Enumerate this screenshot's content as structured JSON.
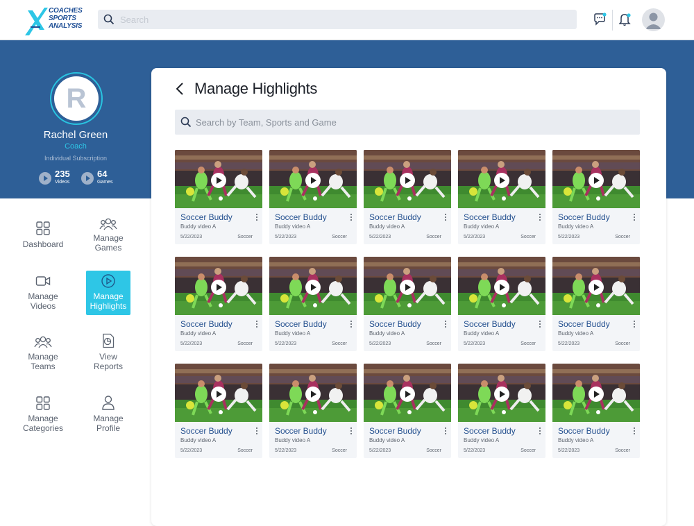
{
  "brand": {
    "logo_text": "COACHES SPORTS ANALYSIS",
    "accent": "#2ec6e6",
    "primary": "#2e5f97"
  },
  "topbar": {
    "search_placeholder": "Search",
    "icons": [
      "search-icon",
      "chat-icon",
      "bell-icon",
      "user-avatar"
    ]
  },
  "profile": {
    "initial": "R",
    "name": "Rachel Green",
    "role": "Coach",
    "subscription": "Individual Subscription",
    "stats": [
      {
        "value": "235",
        "label": "Videos"
      },
      {
        "value": "64",
        "label": "Games"
      }
    ]
  },
  "sidebar": {
    "items": [
      {
        "label": "Dashboard",
        "icon": "grid-icon"
      },
      {
        "label": "Manage Games",
        "icon": "users-icon"
      },
      {
        "label": "Manage Videos",
        "icon": "video-icon"
      },
      {
        "label": "Manage Highlights",
        "icon": "play-circle-icon",
        "active": true
      },
      {
        "label": "Manage Teams",
        "icon": "team-icon"
      },
      {
        "label": "View Reports",
        "icon": "report-icon"
      },
      {
        "label": "Manage Categories",
        "icon": "grid-icon"
      },
      {
        "label": "Manage Profile",
        "icon": "profile-icon"
      }
    ]
  },
  "main": {
    "title": "Manage Highlights",
    "search_placeholder": "Search by Team, Sports and Game",
    "cards": [
      {
        "title": "Soccer Buddy",
        "subtitle": "Buddy video A",
        "date": "5/22/2023",
        "category": "Soccer"
      },
      {
        "title": "Soccer Buddy",
        "subtitle": "Buddy video A",
        "date": "5/22/2023",
        "category": "Soccer"
      },
      {
        "title": "Soccer Buddy",
        "subtitle": "Buddy video A",
        "date": "5/22/2023",
        "category": "Soccer"
      },
      {
        "title": "Soccer Buddy",
        "subtitle": "Buddy video A",
        "date": "5/22/2023",
        "category": "Soccer"
      },
      {
        "title": "Soccer Buddy",
        "subtitle": "Buddy video A",
        "date": "5/22/2023",
        "category": "Soccer"
      },
      {
        "title": "Soccer Buddy",
        "subtitle": "Buddy video A",
        "date": "5/22/2023",
        "category": "Soccer"
      },
      {
        "title": "Soccer Buddy",
        "subtitle": "Buddy video A",
        "date": "5/22/2023",
        "category": "Soccer"
      },
      {
        "title": "Soccer Buddy",
        "subtitle": "Buddy video A",
        "date": "5/22/2023",
        "category": "Soccer"
      },
      {
        "title": "Soccer Buddy",
        "subtitle": "Buddy video A",
        "date": "5/22/2023",
        "category": "Soccer"
      },
      {
        "title": "Soccer Buddy",
        "subtitle": "Buddy video A",
        "date": "5/22/2023",
        "category": "Soccer"
      },
      {
        "title": "Soccer Buddy",
        "subtitle": "Buddy video A",
        "date": "5/22/2023",
        "category": "Soccer"
      },
      {
        "title": "Soccer Buddy",
        "subtitle": "Buddy video A",
        "date": "5/22/2023",
        "category": "Soccer"
      },
      {
        "title": "Soccer Buddy",
        "subtitle": "Buddy video A",
        "date": "5/22/2023",
        "category": "Soccer"
      },
      {
        "title": "Soccer Buddy",
        "subtitle": "Buddy video A",
        "date": "5/22/2023",
        "category": "Soccer"
      },
      {
        "title": "Soccer Buddy",
        "subtitle": "Buddy video A",
        "date": "5/22/2023",
        "category": "Soccer"
      }
    ]
  }
}
